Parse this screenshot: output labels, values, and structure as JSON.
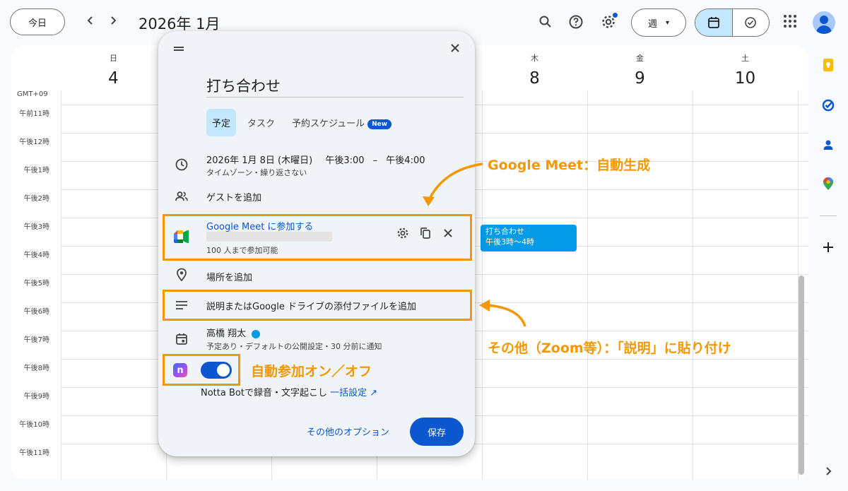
{
  "topbar": {
    "today_label": "今日",
    "prev_label": "‹",
    "next_label": "›",
    "month_title": "2026年 1月",
    "view_label": "週",
    "view_caret": "▾"
  },
  "calendar": {
    "timezone_label": "GMT+09",
    "days": [
      {
        "name": "日",
        "num": "4"
      },
      {
        "name": "月",
        "num": "5"
      },
      {
        "name": "火",
        "num": "6"
      },
      {
        "name": "水",
        "num": "7"
      },
      {
        "name": "木",
        "num": "8"
      },
      {
        "name": "金",
        "num": "9"
      },
      {
        "name": "土",
        "num": "10"
      }
    ],
    "hours": [
      "午前11時",
      "午後12時",
      "午後1時",
      "午後2時",
      "午後3時",
      "午後4時",
      "午後5時",
      "午後6時",
      "午後7時",
      "午後8時",
      "午後9時",
      "午後10時",
      "午後11時"
    ],
    "event": {
      "title": "打ち合わせ",
      "time": "午後3時〜4時",
      "color": "#039be5"
    }
  },
  "modal": {
    "close_label": "✕",
    "title": "打ち合わせ",
    "tabs": [
      {
        "label": "予定"
      },
      {
        "label": "タスク"
      },
      {
        "label": "予約スケジュール"
      }
    ],
    "new_badge": "New",
    "datetime": {
      "date": "2026年 1月 8日 (木曜日)",
      "start": "午後3:00",
      "dash": "–",
      "end": "午後4:00",
      "sub": "タイムゾーン・繰り返さない"
    },
    "guests_label": "ゲストを追加",
    "meet": {
      "join_brand": "Google Meet",
      "join_suffix": " に参加する",
      "capacity": "100 人まで参加可能"
    },
    "location_label": "場所を追加",
    "description_label": "説明またはGoogle ドライブの添付ファイルを追加",
    "calendar_owner": {
      "name": "高橋 翔太",
      "sub": "予定あり・デフォルトの公開設定・30 分前に通知"
    },
    "notta": {
      "icon_letter": "n",
      "text": "Notta Botで録音・文字起こし",
      "link": "一括設定 ↗",
      "toggle_on": true
    },
    "more_options_label": "その他のオプション",
    "save_label": "保存"
  },
  "annotations": {
    "meet_auto": "Google Meet：自動生成",
    "other_paste": "その他（Zoom等）：「説明」に貼り付け",
    "auto_join": "自動参加オン／オフ",
    "accent_color": "#f39800"
  },
  "colors": {
    "primary": "#0b57d0",
    "event": "#039be5",
    "annotation": "#f39800"
  }
}
